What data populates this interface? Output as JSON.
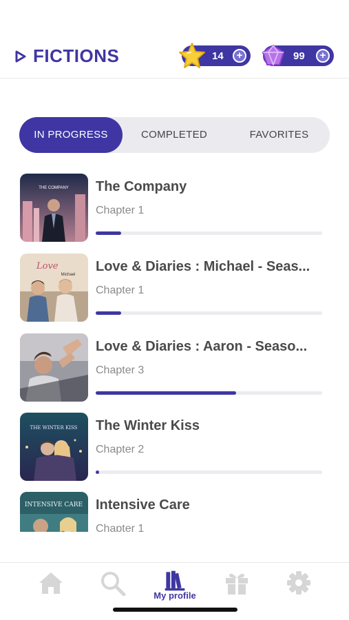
{
  "header": {
    "title": "FICTIONS",
    "stars_count": "14",
    "gems_count": "99"
  },
  "tabs": [
    {
      "label": "IN PROGRESS",
      "active": true
    },
    {
      "label": "COMPLETED",
      "active": false
    },
    {
      "label": "FAVORITES",
      "active": false
    }
  ],
  "stories": [
    {
      "title": "The Company",
      "chapter": "Chapter 1",
      "progress": 0.11,
      "cover_text": "THE COMPANY"
    },
    {
      "title": "Love & Diaries : Michael - Seas...",
      "chapter": "Chapter 1",
      "progress": 0.11,
      "cover_text": "Love Michael"
    },
    {
      "title": "Love & Diaries : Aaron - Seaso...",
      "chapter": "Chapter 3",
      "progress": 0.62,
      "cover_text": ""
    },
    {
      "title": "The Winter Kiss",
      "chapter": "Chapter 2",
      "progress": 0.01,
      "cover_text": "THE WINTER KISS"
    },
    {
      "title": "Intensive Care",
      "chapter": "Chapter 1",
      "progress": 0.0,
      "cover_text": "INTENSIVE CARE"
    }
  ],
  "bottom_nav": [
    {
      "icon": "home-icon",
      "label": ""
    },
    {
      "icon": "search-icon",
      "label": ""
    },
    {
      "icon": "bookshelf-icon",
      "label": "My profile"
    },
    {
      "icon": "gift-icon",
      "label": ""
    },
    {
      "icon": "gear-icon",
      "label": ""
    }
  ],
  "colors": {
    "accent": "#3f36a3",
    "inactive_icon": "#d6d6d6",
    "track": "#ececf0"
  }
}
